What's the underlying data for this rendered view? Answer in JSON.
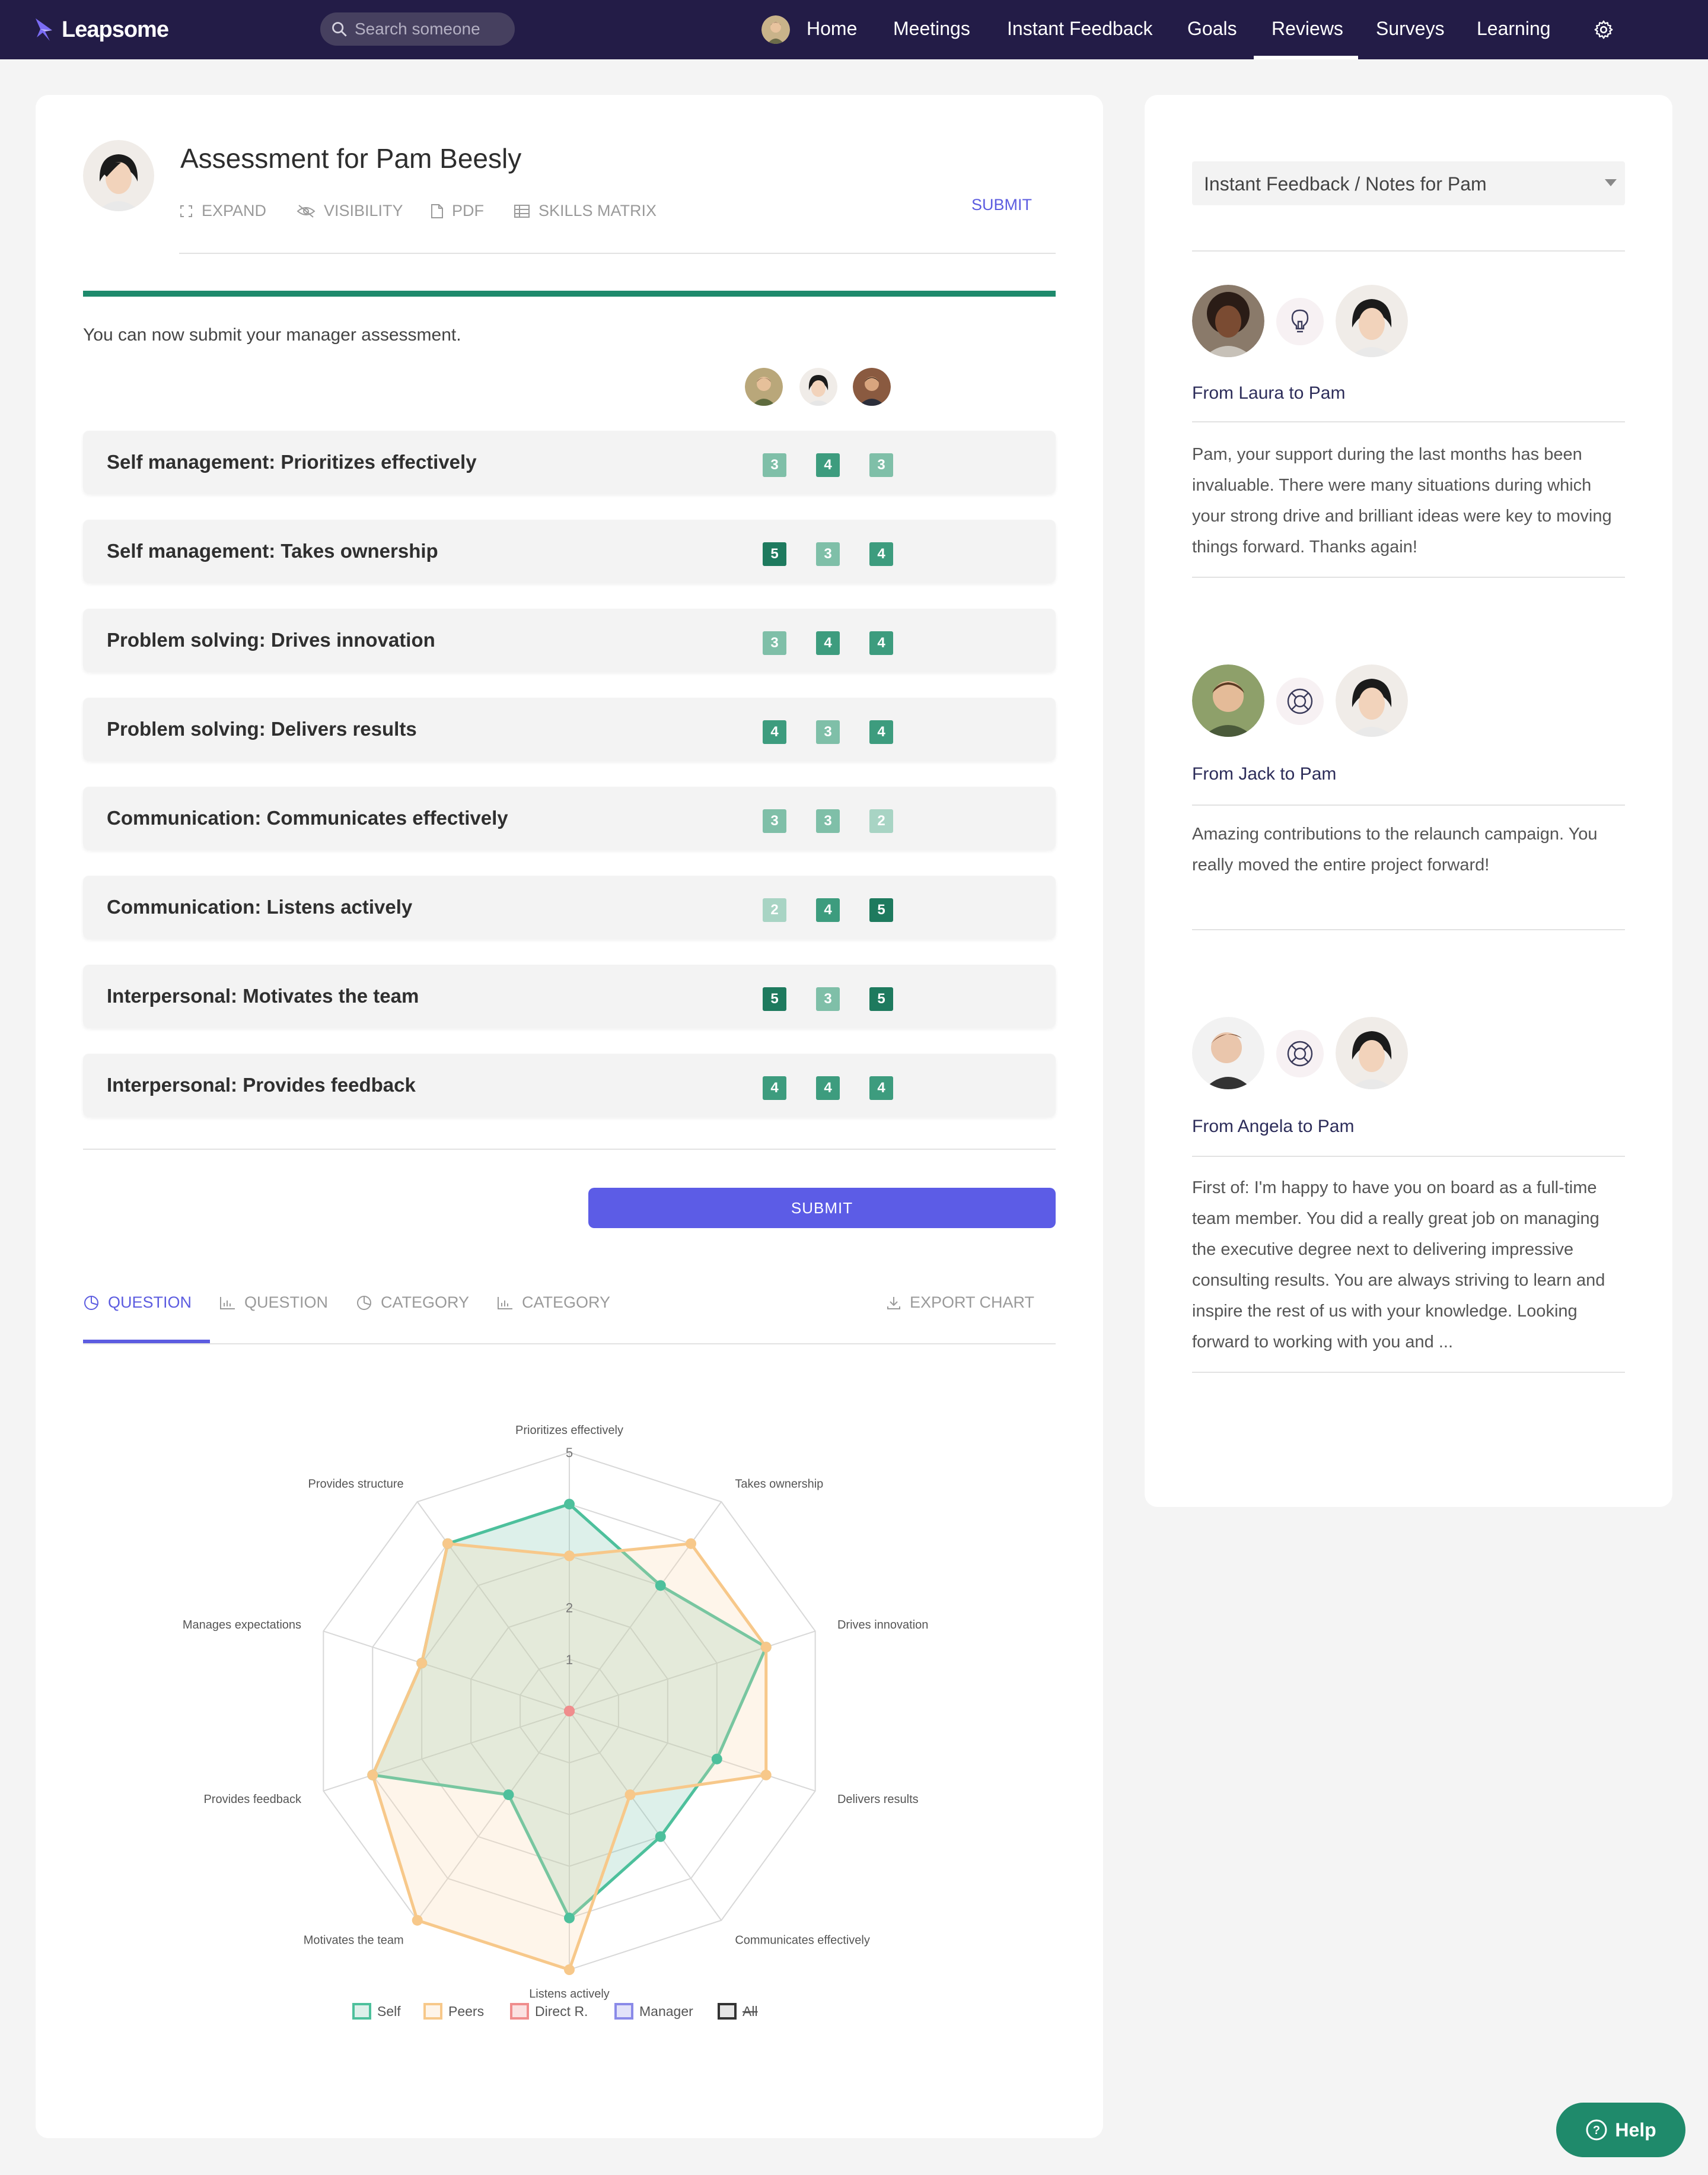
{
  "nav": {
    "brand": "Leapsome",
    "search_placeholder": "Search someone",
    "items": [
      "Home",
      "Meetings",
      "Instant Feedback",
      "Goals",
      "Reviews",
      "Surveys",
      "Learning"
    ],
    "active": "Reviews"
  },
  "assessment": {
    "title": "Assessment for Pam Beesly",
    "tools": [
      "EXPAND",
      "VISIBILITY",
      "PDF",
      "SKILLS MATRIX"
    ],
    "submit_link": "SUBMIT",
    "notice": "You can now submit your manager assessment.",
    "submit_button": "SUBMIT",
    "rows": [
      {
        "label": "Self management: Prioritizes effectively",
        "scores": [
          "3",
          "4",
          "3"
        ]
      },
      {
        "label": "Self management: Takes ownership",
        "scores": [
          "5",
          "3",
          "4"
        ]
      },
      {
        "label": "Problem solving: Drives innovation",
        "scores": [
          "3",
          "4",
          "4"
        ]
      },
      {
        "label": "Problem solving: Delivers results",
        "scores": [
          "4",
          "3",
          "4"
        ]
      },
      {
        "label": "Communication: Communicates effectively",
        "scores": [
          "3",
          "3",
          "2"
        ]
      },
      {
        "label": "Communication: Listens actively",
        "scores": [
          "2",
          "4",
          "5"
        ]
      },
      {
        "label": "Interpersonal: Motivates the team",
        "scores": [
          "5",
          "3",
          "5"
        ]
      },
      {
        "label": "Interpersonal: Provides feedback",
        "scores": [
          "4",
          "4",
          "4"
        ]
      }
    ],
    "score_colors": {
      "2": "#a8d4c4",
      "3": "#7fbfa8",
      "4": "#3d9c7e",
      "5": "#1e7a5e"
    }
  },
  "chart_tabs": {
    "tabs": [
      "QUESTION",
      "QUESTION",
      "CATEGORY",
      "CATEGORY"
    ],
    "export": "EXPORT CHART"
  },
  "chart_data": {
    "type": "radar",
    "axes": [
      "Prioritizes effectively",
      "Takes ownership",
      "Drives innovation",
      "Delivers results",
      "Communicates effectively",
      "Listens actively",
      "Motivates the team",
      "Provides feedback",
      "Manages expectations",
      "Provides structure"
    ],
    "range": [
      0,
      5
    ],
    "tick_labels": [
      "1",
      "2",
      "5"
    ],
    "series": [
      {
        "name": "Self",
        "values": [
          4,
          3,
          4,
          3,
          3,
          4,
          2,
          4,
          3,
          4
        ],
        "color": "#4dc09c",
        "fill": "rgba(120,195,170,0.25)"
      },
      {
        "name": "Peers",
        "values": [
          3,
          4,
          4,
          4,
          2,
          5,
          5,
          4,
          3,
          4
        ],
        "color": "#f7c88a",
        "fill": "rgba(250,215,170,0.25)"
      },
      {
        "name": "Direct R.",
        "values": [
          0,
          0,
          0,
          0,
          0,
          0,
          0,
          0,
          0,
          0
        ],
        "color": "#f08d8d",
        "fill": "rgba(240,141,141,0.25)"
      },
      {
        "name": "Manager",
        "values": [],
        "color": "#8a8ae8",
        "fill": "rgba(138,138,232,0.25)"
      },
      {
        "name": "All",
        "values": [],
        "color": "#333333",
        "fill": "rgba(0,0,0,0.1)"
      }
    ],
    "legend_position": "bottom"
  },
  "side": {
    "dropdown": "Instant Feedback / Notes for Pam",
    "feedback": [
      {
        "from": "From Laura to Pam",
        "text": "Pam, your support during the last months has been invaluable. There were many situations during which your strong drive and brilliant ideas were key to moving things forward. Thanks again!",
        "icon": "lightbulb-icon"
      },
      {
        "from": "From Jack to Pam",
        "text": "Amazing contributions to the relaunch campaign. You really moved the entire project forward!",
        "icon": "lifebuoy-icon"
      },
      {
        "from": "From Angela to Pam",
        "text": "First of: I'm happy to have you on board as a full-time team member. You did a really great job on managing the executive degree next to delivering impressive consulting results. You are always striving to learn and inspire the rest of us with your knowledge. Looking forward to working with you and ...",
        "icon": "lifebuoy-icon"
      }
    ]
  },
  "help": "Help"
}
